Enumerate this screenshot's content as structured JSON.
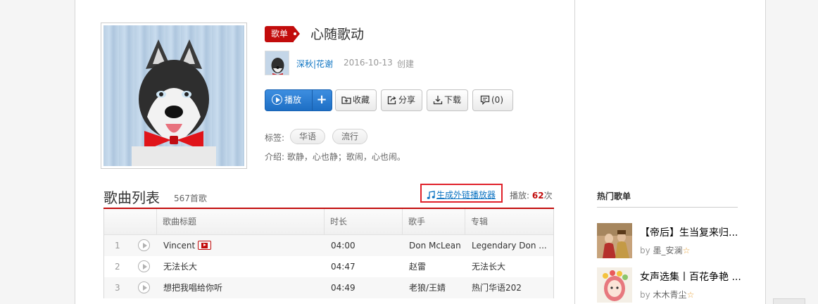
{
  "playlist": {
    "badge": "歌单",
    "title": "心随歌动",
    "creator": "深秋|花谢",
    "date": "2016-10-13",
    "date_suffix": "创建"
  },
  "actions": {
    "play": "播放",
    "add": "+",
    "favorite": "收藏",
    "share": "分享",
    "download": "下载",
    "comment": "(0)"
  },
  "tags": {
    "label": "标签:",
    "items": [
      "华语",
      "流行"
    ]
  },
  "intro": "介绍:  歌静，心也静；歌闹，心也闹。",
  "song_list": {
    "title": "歌曲列表",
    "count": "567首歌",
    "ext_link": "生成外链播放器",
    "play_label": "播放:",
    "play_count": "62",
    "play_suffix": "次",
    "columns": [
      "歌曲标题",
      "时长",
      "歌手",
      "专辑"
    ],
    "rows": [
      {
        "num": "1",
        "title": "Vincent",
        "duration": "04:00",
        "artist": "Don McLean",
        "album": "Legendary Don ..."
      },
      {
        "num": "2",
        "title": "无法长大",
        "duration": "04:47",
        "artist": "赵雷",
        "album": "无法长大"
      },
      {
        "num": "3",
        "title": "想把我唱给你听",
        "duration": "04:49",
        "artist": "老狼/王婧",
        "album": "热门华语202"
      }
    ]
  },
  "sidebar": {
    "title": "热门歌单",
    "items": [
      {
        "name": "【帝后】生当复来归...",
        "by": "by",
        "user": "墨_安澜"
      },
      {
        "name": "女声选集丨百花争艳 ...",
        "by": "by",
        "user": "木木青尘"
      }
    ]
  },
  "colors": {
    "accent_red": "#c20c0c",
    "link_blue": "#0c73c2",
    "play_blue": "#2b7cd3",
    "highlight_box": "#e0212a"
  }
}
